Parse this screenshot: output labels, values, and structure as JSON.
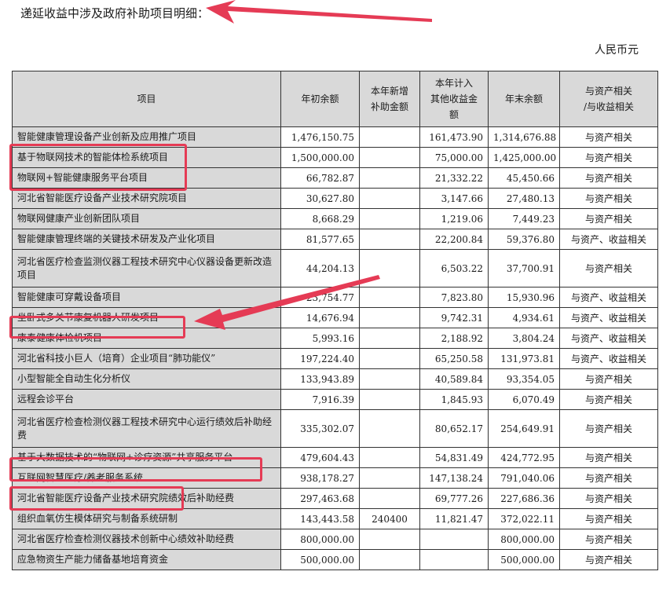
{
  "title": "递延收益中涉及政府补助项目明细：",
  "unit": "人民币元",
  "colors": {
    "highlight": "#e53b55",
    "header_bg": "#d9d9d9"
  },
  "table": {
    "headers": [
      "项目",
      "年初余额",
      "本年新增\n补助金额",
      "本年计入\n其他收益金\n额",
      "年末余额",
      "与资产相关\n/与收益相关"
    ],
    "rows": [
      [
        "智能健康管理设备产业创新及应用推广项目",
        "1,476,150.75",
        "",
        "161,473.90",
        "1,314,676.88",
        "与资产相关"
      ],
      [
        "基于物联网技术的智能体检系统项目",
        "1,500,000.00",
        "",
        "75,000.00",
        "1,425,000.00",
        "与资产相关"
      ],
      [
        "物联网+智能健康服务平台项目",
        "66,782.87",
        "",
        "21,332.22",
        "45,450.66",
        "与资产相关"
      ],
      [
        "河北省智能医疗设备产业技术研究院项目",
        "30,627.80",
        "",
        "3,147.66",
        "27,480.13",
        "与资产相关"
      ],
      [
        "物联网健康产业创新团队项目",
        "8,668.29",
        "",
        "1,219.06",
        "7,449.23",
        "与资产相关"
      ],
      [
        "智能健康管理终端的关键技术研发及产业化项目",
        "81,577.65",
        "",
        "22,200.84",
        "59,376.80",
        "与资产、收益相关"
      ],
      [
        "河北省医疗检查监测仪器工程技术研究中心仪器设备更新改造项目",
        "44,204.13",
        "",
        "6,503.22",
        "37,700.91",
        "与资产相关"
      ],
      [
        "智能健康可穿戴设备项目",
        "23,754.77",
        "",
        "7,823.80",
        "15,930.96",
        "与资产、收益相关"
      ],
      [
        "坐卧式多关节康复机器人研发项目",
        "14,676.94",
        "",
        "9,742.31",
        "4,934.61",
        "与资产、收益相关"
      ],
      [
        "康泰健康体检机项目",
        "5,993.16",
        "",
        "2,188.92",
        "3,804.24",
        "与资产、收益相关"
      ],
      [
        "河北省科技小巨人（培育）企业项目“肺功能仪”",
        "197,224.40",
        "",
        "65,250.58",
        "131,973.81",
        "与资产、收益相关"
      ],
      [
        "小型智能全自动生化分析仪",
        "133,943.89",
        "",
        "40,589.84",
        "93,354.05",
        "与资产相关"
      ],
      [
        "远程会诊平台",
        "7,916.39",
        "",
        "1,845.93",
        "6,070.49",
        "与资产相关"
      ],
      [
        "河北省医疗检查检测仪器工程技术研究中心运行绩效后补助经费",
        "335,302.07",
        "",
        "80,652.17",
        "254,649.91",
        "与资产相关"
      ],
      [
        "基于大数据技术的“物联网+诊疗资源”共享服务平台",
        "479,604.43",
        "",
        "54,831.49",
        "424,772.95",
        "与资产相关"
      ],
      [
        "互联网智慧医疗/养老服务系统",
        "938,178.27",
        "",
        "147,138.24",
        "791,040.06",
        "与资产相关"
      ],
      [
        "河北省智能医疗设备产业技术研究院绩效后补助经费",
        "297,463.68",
        "",
        "69,777.26",
        "227,686.36",
        "与资产相关"
      ],
      [
        "组织血氧仿生模体研究与制备系统研制",
        "143,443.58",
        "240400",
        "11,821.47",
        "372,022.11",
        "与资产相关"
      ],
      [
        "河北省医疗检查检测仪器技术创新中心绩效补助经费",
        "800,000.00",
        "",
        "",
        "800,000.00",
        "与资产相关"
      ],
      [
        "应急物资生产能力储备基地培育资金",
        "500,000.00",
        "",
        "",
        "500,000.00",
        "与资产相关"
      ]
    ]
  }
}
